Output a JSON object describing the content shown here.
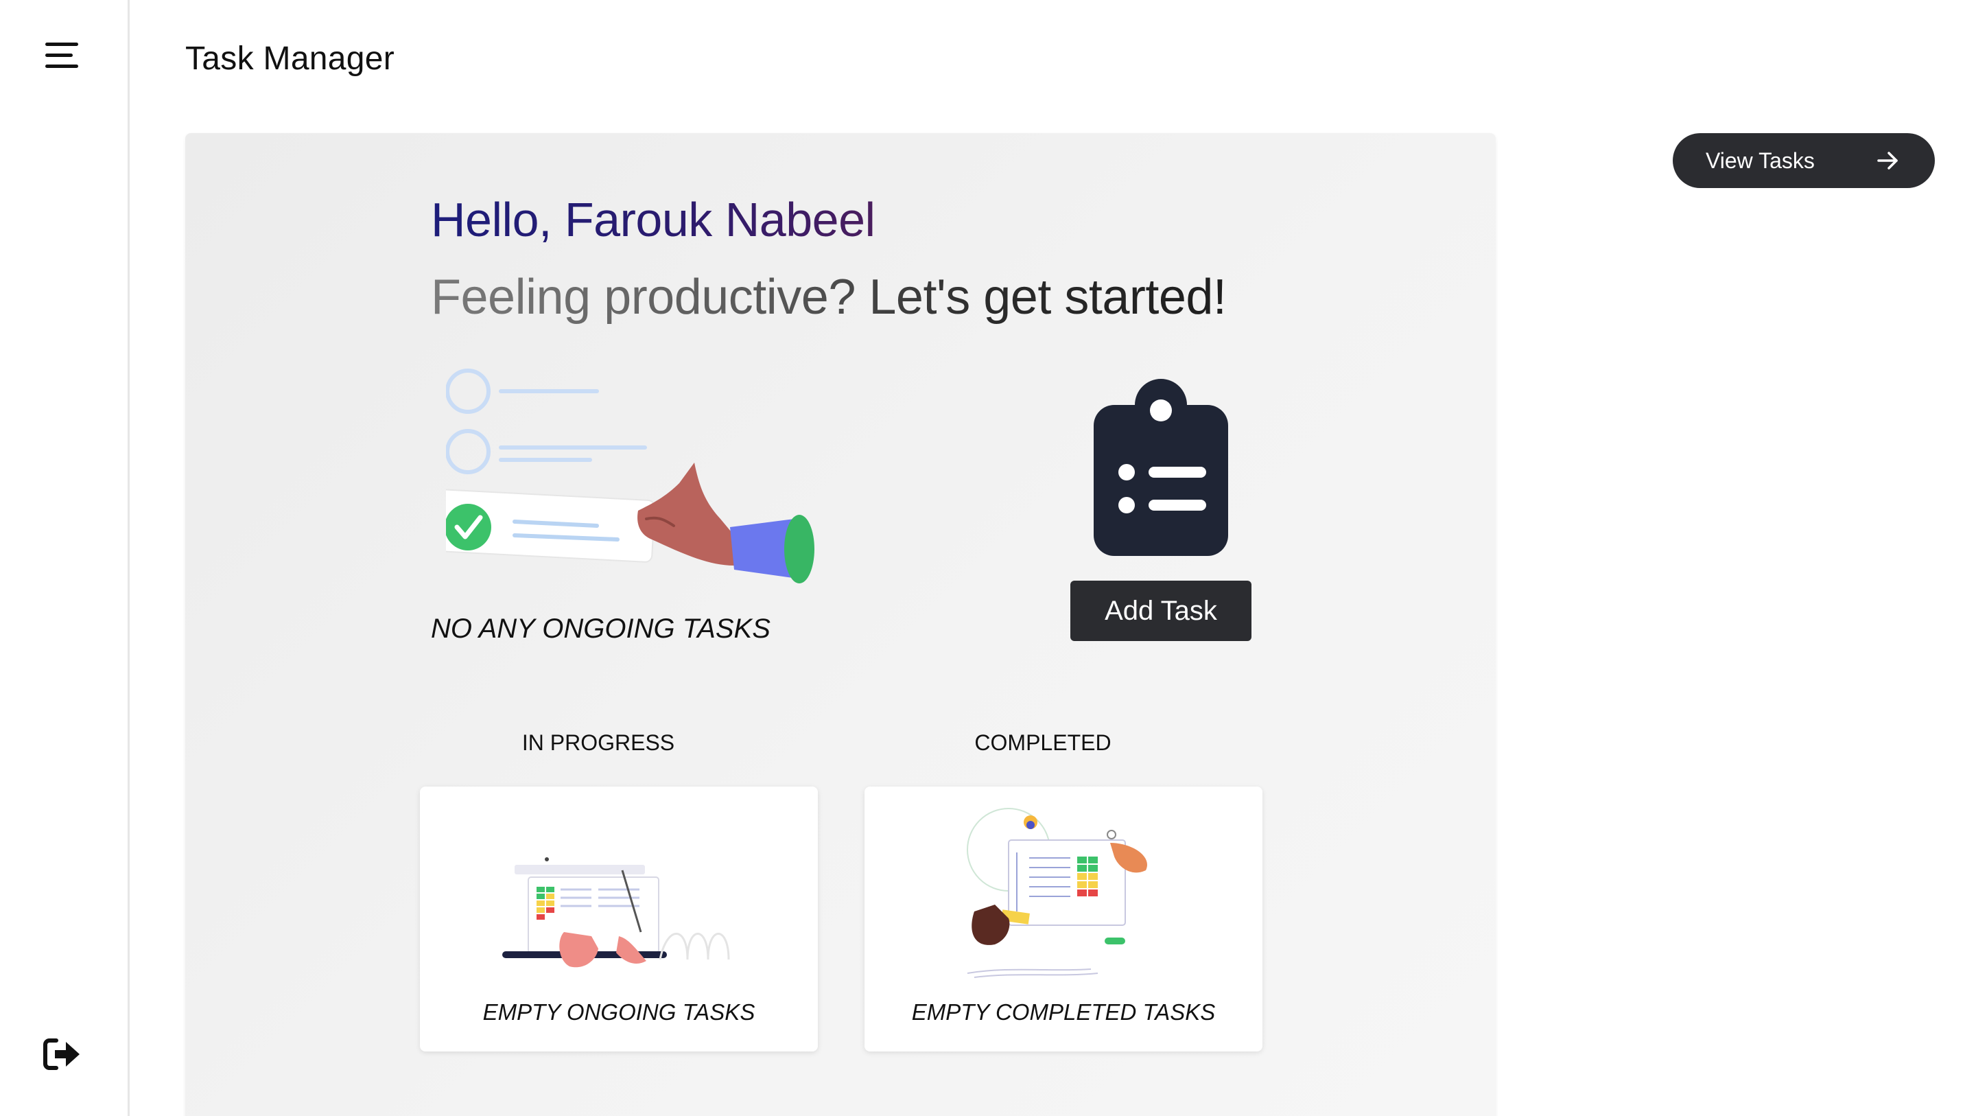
{
  "app": {
    "title": "Task Manager"
  },
  "sidebar": {
    "menu_icon": "menu-icon",
    "logout_icon": "logout-icon"
  },
  "header": {
    "view_tasks_label": "View Tasks",
    "view_tasks_icon": "arrow-right-icon"
  },
  "welcome": {
    "greeting": "Hello, Farouk Nabeel",
    "subtitle": "Feeling productive? Let's get started!",
    "no_ongoing": "NO ANY ONGOING TASKS",
    "add_task_label": "Add Task",
    "clipboard_icon": "clipboard-list-icon"
  },
  "columns": [
    {
      "label": "IN PROGRESS",
      "caption": "EMPTY ONGOING TASKS"
    },
    {
      "label": "COMPLETED",
      "caption": "EMPTY COMPLETED TASKS"
    }
  ],
  "colors": {
    "dark_button": "#2b2c30",
    "greeting_start": "#1d1d7a",
    "greeting_end": "#4a1d5e",
    "check_green": "#3cc26a"
  }
}
